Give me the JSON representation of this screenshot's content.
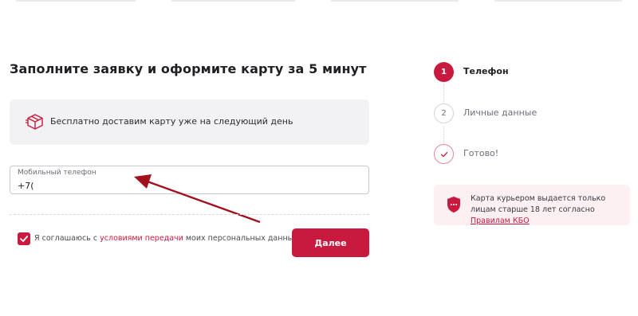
{
  "page": {
    "title": "Заполните заявку и оформите карту за 5 минут"
  },
  "notice": {
    "icon": "delivery-box-icon",
    "text": "Бесплатно доставим карту уже на следующий день"
  },
  "phone_field": {
    "label": "Мобильный телефон",
    "value": "+7("
  },
  "consent": {
    "checked": true,
    "text_before": "Я соглашаюсь с",
    "link_text": "условиями передачи",
    "text_after": "моих персональных данных"
  },
  "next_button": {
    "label": "Далее"
  },
  "steps": [
    {
      "number": "1",
      "label": "Телефон",
      "state": "active"
    },
    {
      "number": "2",
      "label": "Личные данные",
      "state": "inactive"
    },
    {
      "number": "",
      "label": "Готово!",
      "state": "done",
      "icon": "check-icon"
    }
  ],
  "info": {
    "icon": "shield-icon",
    "text": "Карта курьером выдается только лицам старше 18 лет согласно",
    "link_text": "Правилам КБО"
  },
  "colors": {
    "accent": "#c8193e",
    "notice_bg": "#f2f2f4",
    "info_bg": "#fcf0f2"
  }
}
